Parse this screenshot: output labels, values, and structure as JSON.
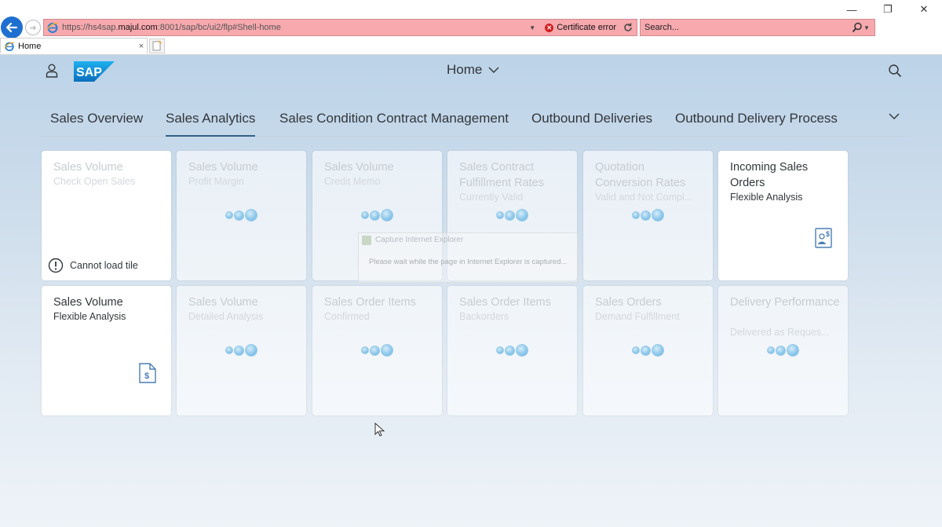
{
  "browser": {
    "address": {
      "url_prefix": "https://hs4sap.",
      "url_domain": "majul.com",
      "url_suffix": ":8001/sap/bc/ui2/flp#Shell-home",
      "cert_error": "Certificate error"
    },
    "search_placeholder": "Search...",
    "tab_label": "Home",
    "tab_close": "×",
    "window_controls": [
      "—",
      "❐",
      "✕"
    ]
  },
  "shell": {
    "title": "Home"
  },
  "anchor_bar": {
    "items": [
      {
        "label": "Sales Overview",
        "active": false
      },
      {
        "label": "Sales Analytics",
        "active": true
      },
      {
        "label": "Sales Condition Contract Management",
        "active": false
      },
      {
        "label": "Outbound Deliveries",
        "active": false
      },
      {
        "label": "Outbound Delivery Process",
        "active": false
      }
    ]
  },
  "tiles": [
    {
      "title": "Sales Volume",
      "subtitle": "Check Open Sales",
      "state": "error",
      "error_text": "Cannot load tile"
    },
    {
      "title": "Sales Volume",
      "subtitle": "Profit Margin",
      "state": "loading"
    },
    {
      "title": "Sales Volume",
      "subtitle": "Credit Memo",
      "state": "loading"
    },
    {
      "title": "Sales Contract Fulfillment Rates",
      "subtitle": "Currently Valid",
      "state": "loading"
    },
    {
      "title": "Quotation Conversion Rates",
      "subtitle": "Valid and Not Compl...",
      "state": "loading"
    },
    {
      "title": "Incoming Sales Orders",
      "subtitle": "Flexible Analysis",
      "state": "loaded",
      "icon": "analysis-person-icon"
    },
    {
      "title": "Sales Volume",
      "subtitle": "Flexible Analysis",
      "state": "loaded",
      "icon": "document-dollar-icon"
    },
    {
      "title": "Sales Volume",
      "subtitle": "Detailed Analysis",
      "state": "loading"
    },
    {
      "title": "Sales Order Items",
      "subtitle": "Confirmed",
      "state": "loading"
    },
    {
      "title": "Sales Order Items",
      "subtitle": "Backorders",
      "state": "loading"
    },
    {
      "title": "Sales Orders",
      "subtitle": "Demand Fulfillment",
      "state": "loading"
    },
    {
      "title": "Delivery Performance",
      "subtitle": "Delivered as Reques...",
      "state": "loading"
    }
  ],
  "capture_dialog": {
    "title": "Capture Internet Explorer",
    "message": "Please wait while the page in Internet Explorer is captured..."
  },
  "colors": {
    "address_bar_error": "#f7a9ae",
    "back_button": "#1e6fd0",
    "sap_logo": "#1a8fd6",
    "anchor_active": "#346187",
    "loading_dot": "#8fc9ec"
  }
}
